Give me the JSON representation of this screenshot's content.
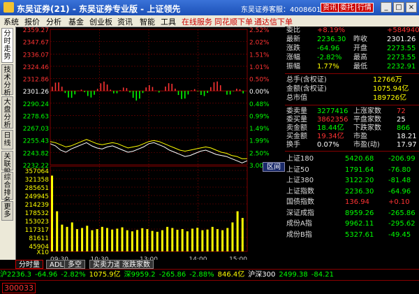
{
  "app": {
    "title": "东吴证券(21) - 东吴证券专业版 - 上证领先",
    "hotline": "东吴证券客服：4008601555",
    "btn_info": "资讯",
    "btn_trade": "委托",
    "btn_quote": "行情"
  },
  "window_controls": {
    "minimize": "_",
    "maximize": "□",
    "close": "×"
  },
  "menu": [
    "系统",
    "报价",
    "分析",
    "基金",
    "创业板",
    "资讯",
    "智能",
    "工具",
    "在线服务",
    "同花顺下单",
    "通达信下单"
  ],
  "sidebar_tabs": [
    "分时走势",
    "技术分析",
    "大盘分析",
    "日线",
    "关联股",
    "综合排名",
    "更多"
  ],
  "chart_data": {
    "type": "line",
    "price_ticks": [
      "2359.27",
      "2347.67",
      "2336.07",
      "2324.46",
      "2312.86",
      "2301.26",
      "2290.24",
      "2278.63",
      "2267.03",
      "2255.43",
      "2243.82",
      "2232.22"
    ],
    "pct_ticks": [
      "2.52%",
      "2.02%",
      "1.51%",
      "1.01%",
      "0.50%",
      "0.00%",
      "0.48%",
      "0.99%",
      "1.49%",
      "1.99%",
      "2.50%",
      "3.00%"
    ],
    "volume_ticks": [
      "357064",
      "321358",
      "285651",
      "249945",
      "214239",
      "178532",
      "153023",
      "117317",
      "81611",
      "45904"
    ],
    "x_ticks": [
      "09:30",
      "10:30",
      "13:00",
      "14:00",
      "15:00"
    ],
    "volume_unit": "X10",
    "range_label": "区间",
    "series": [
      {
        "color": "#ffffff",
        "values": [
          2252,
          2250,
          2246,
          2244,
          2247,
          2249,
          2251,
          2253,
          2250,
          2248,
          2247,
          2249,
          2250,
          2248,
          2246,
          2244,
          2245,
          2247,
          2249,
          2252,
          2253,
          2251,
          2249,
          2246,
          2244,
          2242,
          2240,
          2241,
          2243,
          2245,
          2246,
          2244,
          2242,
          2241,
          2240,
          2238,
          2236,
          2234,
          2236
        ]
      },
      {
        "color": "#ffff00",
        "values": [
          2254,
          2253,
          2251,
          2249,
          2250,
          2252,
          2254,
          2256,
          2254,
          2252,
          2251,
          2252,
          2253,
          2252,
          2250,
          2248,
          2249,
          2250,
          2252,
          2254,
          2255,
          2254,
          2252,
          2250,
          2248,
          2246,
          2245,
          2246,
          2247,
          2248,
          2249,
          2248,
          2246,
          2244,
          2243,
          2241,
          2240,
          2238,
          2238
        ]
      }
    ],
    "volume": [
      340,
      180,
      120,
      110,
      130,
      100,
      105,
      115,
      95,
      100,
      110,
      105,
      98,
      102,
      108,
      95,
      90,
      96,
      104,
      100,
      92,
      88,
      95,
      110,
      105,
      97,
      100,
      90,
      102,
      106,
      95,
      98,
      110,
      100,
      95,
      105,
      130,
      180,
      150
    ]
  },
  "right_panel": {
    "rows": [
      {
        "l": "委比",
        "v": "+8.19%",
        "l2": "",
        "v2": "+584940",
        "vc": "#f33",
        "v2c": "#f33"
      },
      {
        "l": "最新",
        "v": "2236.30",
        "l2": "昨收",
        "v2": "2301.26",
        "vc": "#0f0",
        "v2c": "#fff"
      },
      {
        "l": "涨跌",
        "v": "-64.96",
        "l2": "开盘",
        "v2": "2273.55",
        "vc": "#0f0",
        "v2c": "#0f0"
      },
      {
        "l": "涨幅",
        "v": "-2.82%",
        "l2": "最高",
        "v2": "2273.55",
        "vc": "#0f0",
        "v2c": "#0f0"
      },
      {
        "l": "振幅",
        "v": "1.77%",
        "l2": "最低",
        "v2": "2232.91",
        "vc": "#ff0",
        "v2c": "#0f0"
      }
    ],
    "rows2": [
      {
        "l": "总手(含权证)",
        "v": "12766万",
        "vc": "#ff0"
      },
      {
        "l": "金额(含权证)",
        "v": "1075.94亿",
        "vc": "#ff0"
      },
      {
        "l": "总市值",
        "v": "189726亿",
        "vc": "#ff0"
      }
    ],
    "rows3": [
      {
        "l": "委卖量",
        "v": "3277416",
        "l2": "上涨家数",
        "v2": "72",
        "vc": "#0f0",
        "v2c": "#f33"
      },
      {
        "l": "委买量",
        "v": "3862356",
        "l2": "平盘家数",
        "v2": "25",
        "vc": "#f33",
        "v2c": "#fff"
      },
      {
        "l": "卖金额",
        "v": "18.44亿",
        "l2": "下跌家数",
        "v2": "866",
        "vc": "#0f0",
        "v2c": "#0f0"
      },
      {
        "l": "买金额",
        "v": "19.34亿",
        "l2": "市盈",
        "v2": "18.21",
        "vc": "#f33",
        "v2c": "#fff"
      },
      {
        "l": "换手",
        "v": "0.07%",
        "l2": "市盈(动)",
        "v2": "17.97",
        "vc": "#fff",
        "v2c": "#fff"
      }
    ],
    "indices": [
      {
        "n": "上证180",
        "p": "5420.68",
        "c": "-206.99",
        "pc": "#0f0",
        "cc": "#0f0"
      },
      {
        "n": "上证50",
        "p": "1791.64",
        "c": "-76.80",
        "pc": "#0f0",
        "cc": "#0f0"
      },
      {
        "n": "上证380",
        "p": "3122.20",
        "c": "-81.48",
        "pc": "#0f0",
        "cc": "#0f0"
      },
      {
        "n": "上证指数",
        "p": "2236.30",
        "c": "-64.96",
        "pc": "#0f0",
        "cc": "#0f0"
      },
      {
        "n": "国债指数",
        "p": "136.94",
        "c": "+0.10",
        "pc": "#f33",
        "cc": "#f33"
      },
      {
        "n": "深证成指",
        "p": "8959.26",
        "c": "-265.86",
        "pc": "#0f0",
        "cc": "#0f0"
      },
      {
        "n": "成份A指",
        "p": "9962.11",
        "c": "-295.62",
        "pc": "#0f0",
        "cc": "#0f0"
      },
      {
        "n": "成份B指",
        "p": "5327.61",
        "c": "-49.45",
        "pc": "#0f0",
        "cc": "#0f0"
      }
    ]
  },
  "bottom_tabs": [
    "分时量",
    "ADL",
    "多空",
    "买卖力道",
    "涨跌家数"
  ],
  "ticker": [
    {
      "t": "沪2236.3",
      "c": "#0f0"
    },
    {
      "t": "-64.96",
      "c": "#0f0"
    },
    {
      "t": "-2.82%",
      "c": "#0f0"
    },
    {
      "t": "1075.9亿",
      "c": "#ff0"
    },
    {
      "t": "深9959.2",
      "c": "#0f0"
    },
    {
      "t": "-265.86",
      "c": "#0f0"
    },
    {
      "t": "-2.88%",
      "c": "#0f0"
    },
    {
      "t": "846.4亿",
      "c": "#ff0"
    },
    {
      "t": "沪深300",
      "c": "#fff"
    },
    {
      "t": "2499.38",
      "c": "#0f0"
    },
    {
      "t": "-84.21",
      "c": "#0f0"
    }
  ],
  "status": {
    "code": "300033"
  },
  "colors": {
    "up": "#ff3333",
    "down": "#00ff00",
    "grid": "#800000",
    "accent": "#ffff00"
  }
}
